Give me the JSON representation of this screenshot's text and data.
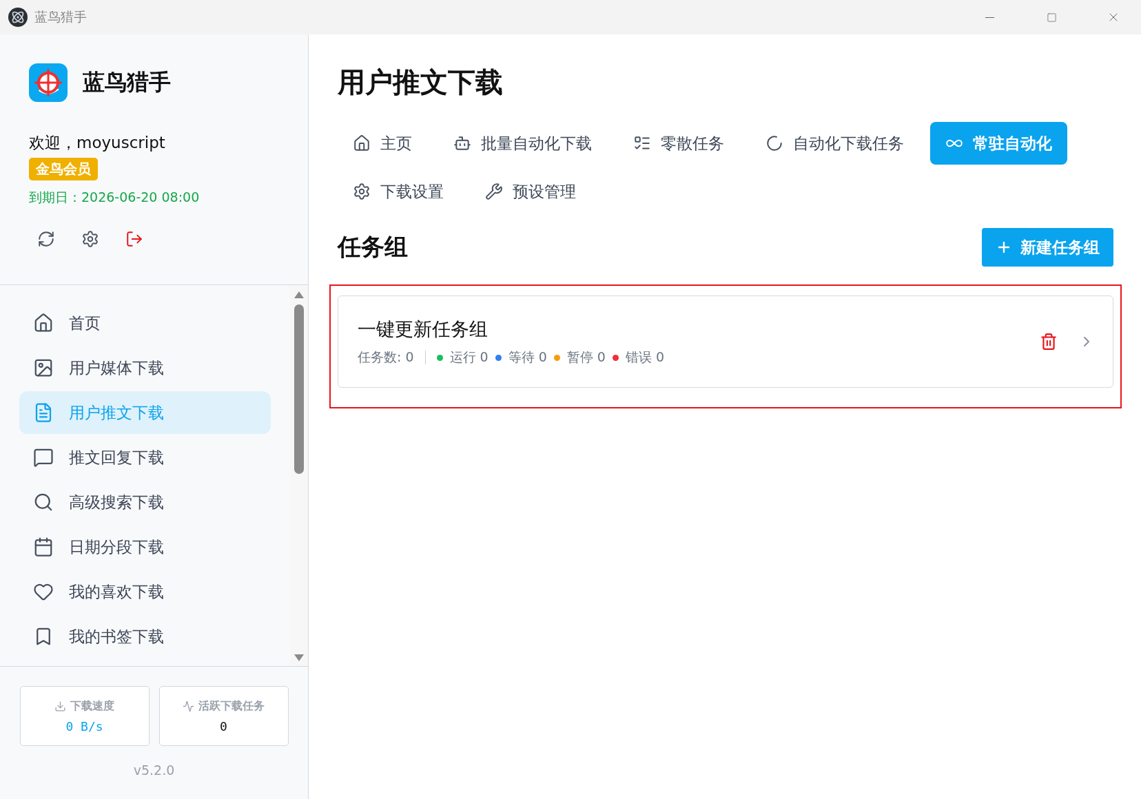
{
  "window": {
    "title": "蓝鸟猎手"
  },
  "sidebar": {
    "app_name": "蓝鸟猎手",
    "welcome": "欢迎，moyuscript",
    "badge": "金鸟会员",
    "expiry_label": "到期日：",
    "expiry": "2026-06-20 08:00",
    "items": [
      {
        "label": "首页",
        "selected": false
      },
      {
        "label": "用户媒体下载",
        "selected": false
      },
      {
        "label": "用户推文下载",
        "selected": true
      },
      {
        "label": "推文回复下载",
        "selected": false
      },
      {
        "label": "高级搜索下载",
        "selected": false
      },
      {
        "label": "日期分段下载",
        "selected": false
      },
      {
        "label": "我的喜欢下载",
        "selected": false
      },
      {
        "label": "我的书签下载",
        "selected": false
      }
    ],
    "stats": [
      {
        "label": "下载速度",
        "value": "0 B/s"
      },
      {
        "label": "活跃下载任务",
        "value": "0"
      }
    ],
    "version": "v5.2.0"
  },
  "main": {
    "title": "用户推文下载",
    "tabs": [
      {
        "label": "主页",
        "selected": false
      },
      {
        "label": "批量自动化下载",
        "selected": false
      },
      {
        "label": "零散任务",
        "selected": false
      },
      {
        "label": "自动化下载任务",
        "selected": false
      },
      {
        "label": "常驻自动化",
        "selected": true
      },
      {
        "label": "下载设置",
        "selected": false
      },
      {
        "label": "预设管理",
        "selected": false
      }
    ],
    "section_title": "任务组",
    "new_button": "新建任务组",
    "groups": [
      {
        "name": "一键更新任务组",
        "count_label": "任务数: 0",
        "statuses": [
          {
            "label": "运行 0",
            "color": "#16c060"
          },
          {
            "label": "等待 0",
            "color": "#2f7ff5"
          },
          {
            "label": "暂停 0",
            "color": "#f59e0b"
          },
          {
            "label": "错误 0",
            "color": "#ef2f3a"
          }
        ]
      }
    ]
  }
}
